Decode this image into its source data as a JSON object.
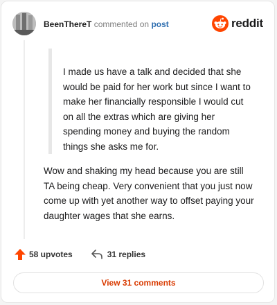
{
  "header": {
    "username": "BeenThereT",
    "action_text": "commented on",
    "post_link": "post",
    "brand_text": "reddit"
  },
  "quote": {
    "text": "I made us have a talk and decided that she would be paid for her work but since I want to make her financially responsible I would cut on all the extras which are giving her spending money and buying the random things she asks me for."
  },
  "comment": {
    "text": "Wow and shaking my head because you are still TA being cheap. Very convenient that you just now come up with yet another way to offset paying your daughter wages that she earns."
  },
  "stats": {
    "upvotes": "58 upvotes",
    "replies": "31 replies"
  },
  "footer": {
    "view_comments": "View 31 comments"
  },
  "colors": {
    "accent": "#d93a00",
    "upvote": "#ff4500",
    "link": "#2f6fb0"
  },
  "icons": {
    "brand": "reddit-logo-icon",
    "upvote": "upvote-arrow-icon",
    "reply": "reply-arrow-icon"
  }
}
